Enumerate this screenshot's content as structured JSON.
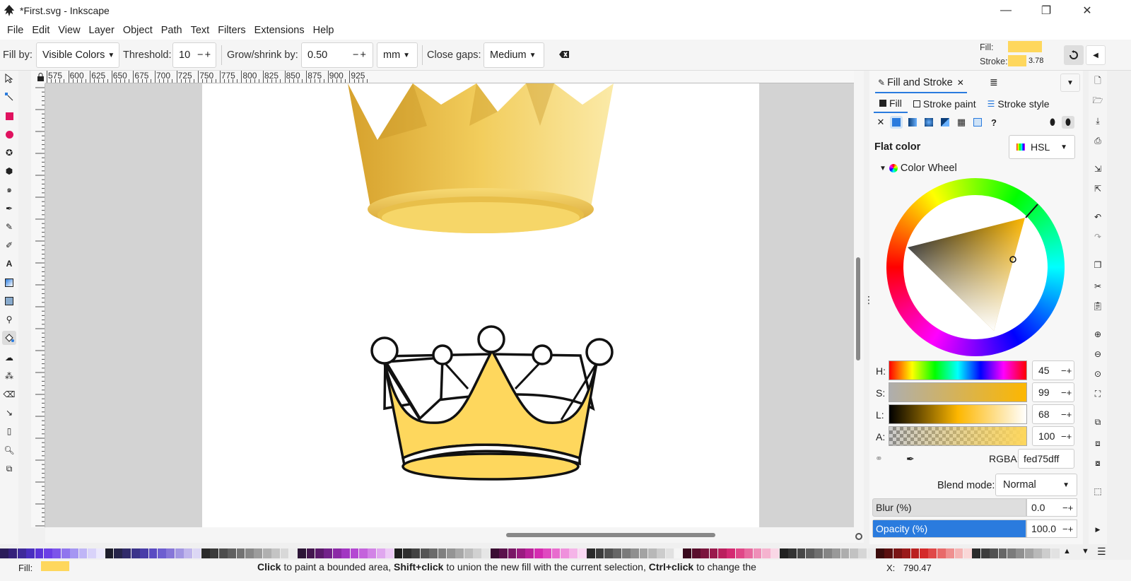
{
  "window": {
    "title": "*First.svg - Inkscape",
    "min": "—",
    "max": "❐",
    "close": "✕"
  },
  "menu": [
    "File",
    "Edit",
    "View",
    "Layer",
    "Object",
    "Path",
    "Text",
    "Filters",
    "Extensions",
    "Help"
  ],
  "tool_controls": {
    "fill_by_label": "Fill by:",
    "fill_by_value": "Visible Colors",
    "threshold_label": "Threshold:",
    "threshold_value": "10",
    "grow_label": "Grow/shrink by:",
    "grow_value": "0.50",
    "unit": "mm",
    "close_gaps_label": "Close gaps:",
    "close_gaps_value": "Medium"
  },
  "style_indicator": {
    "fill_label": "Fill:",
    "stroke_label": "Stroke:",
    "stroke_width": "3.78",
    "color": "#fed75d"
  },
  "ruler_labels": [
    "575",
    "600",
    "625",
    "650",
    "675",
    "700",
    "725",
    "750",
    "775",
    "800",
    "825",
    "850",
    "875",
    "900",
    "925"
  ],
  "panel": {
    "tab_title": "Fill and Stroke",
    "subtabs": [
      "Fill",
      "Stroke paint",
      "Stroke style"
    ],
    "flat_color_label": "Flat color",
    "color_mode": "HSL",
    "wheel_label": "Color Wheel",
    "sliders": [
      {
        "label": "H:",
        "value": "45"
      },
      {
        "label": "S:",
        "value": "99"
      },
      {
        "label": "L:",
        "value": "68"
      },
      {
        "label": "A:",
        "value": "100"
      }
    ],
    "rgba_label": "RGBA:",
    "rgba_value": "fed75dff",
    "blend_label": "Blend mode:",
    "blend_value": "Normal",
    "blur_label": "Blur (%)",
    "blur_value": "0.0",
    "opacity_label": "Opacity (%)",
    "opacity_value": "100.0",
    "opacity_fraction": 1.0
  },
  "status": {
    "fill_label": "Fill:",
    "message_parts": [
      {
        "b": "Click"
      },
      {
        "t": " to paint a bounded area, "
      },
      {
        "b": "Shift+click"
      },
      {
        "t": " to union the new fill with the current selection, "
      },
      {
        "b": "Ctrl+click"
      },
      {
        "t": " to change the"
      }
    ],
    "x_label": "X:",
    "x_value": "790.47"
  },
  "colors": {
    "accent": "#2a7bde",
    "fill": "#fed75d",
    "crown_gold": "#e2b43f"
  }
}
